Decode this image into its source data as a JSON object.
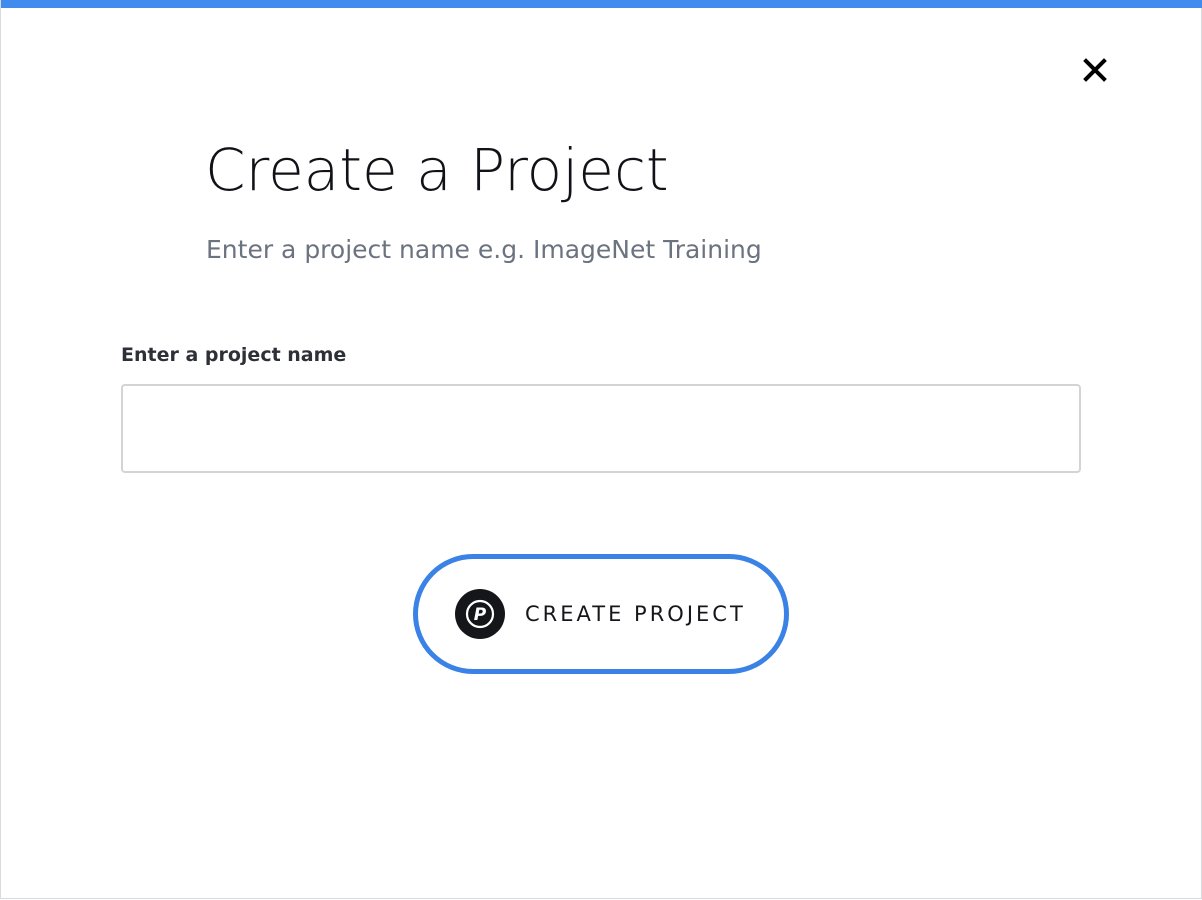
{
  "accent_color": "#418bef",
  "button_border_color": "#3b82e6",
  "modal": {
    "close_icon": "close-icon",
    "title": "Create a Project",
    "subtitle": "Enter a project name e.g. ImageNet Training",
    "form": {
      "name_label": "Enter a project name",
      "name_value": "",
      "name_placeholder": ""
    },
    "create_button": {
      "label": "CREATE PROJECT",
      "icon": "p-logo-icon",
      "logo_letter": "P"
    }
  }
}
